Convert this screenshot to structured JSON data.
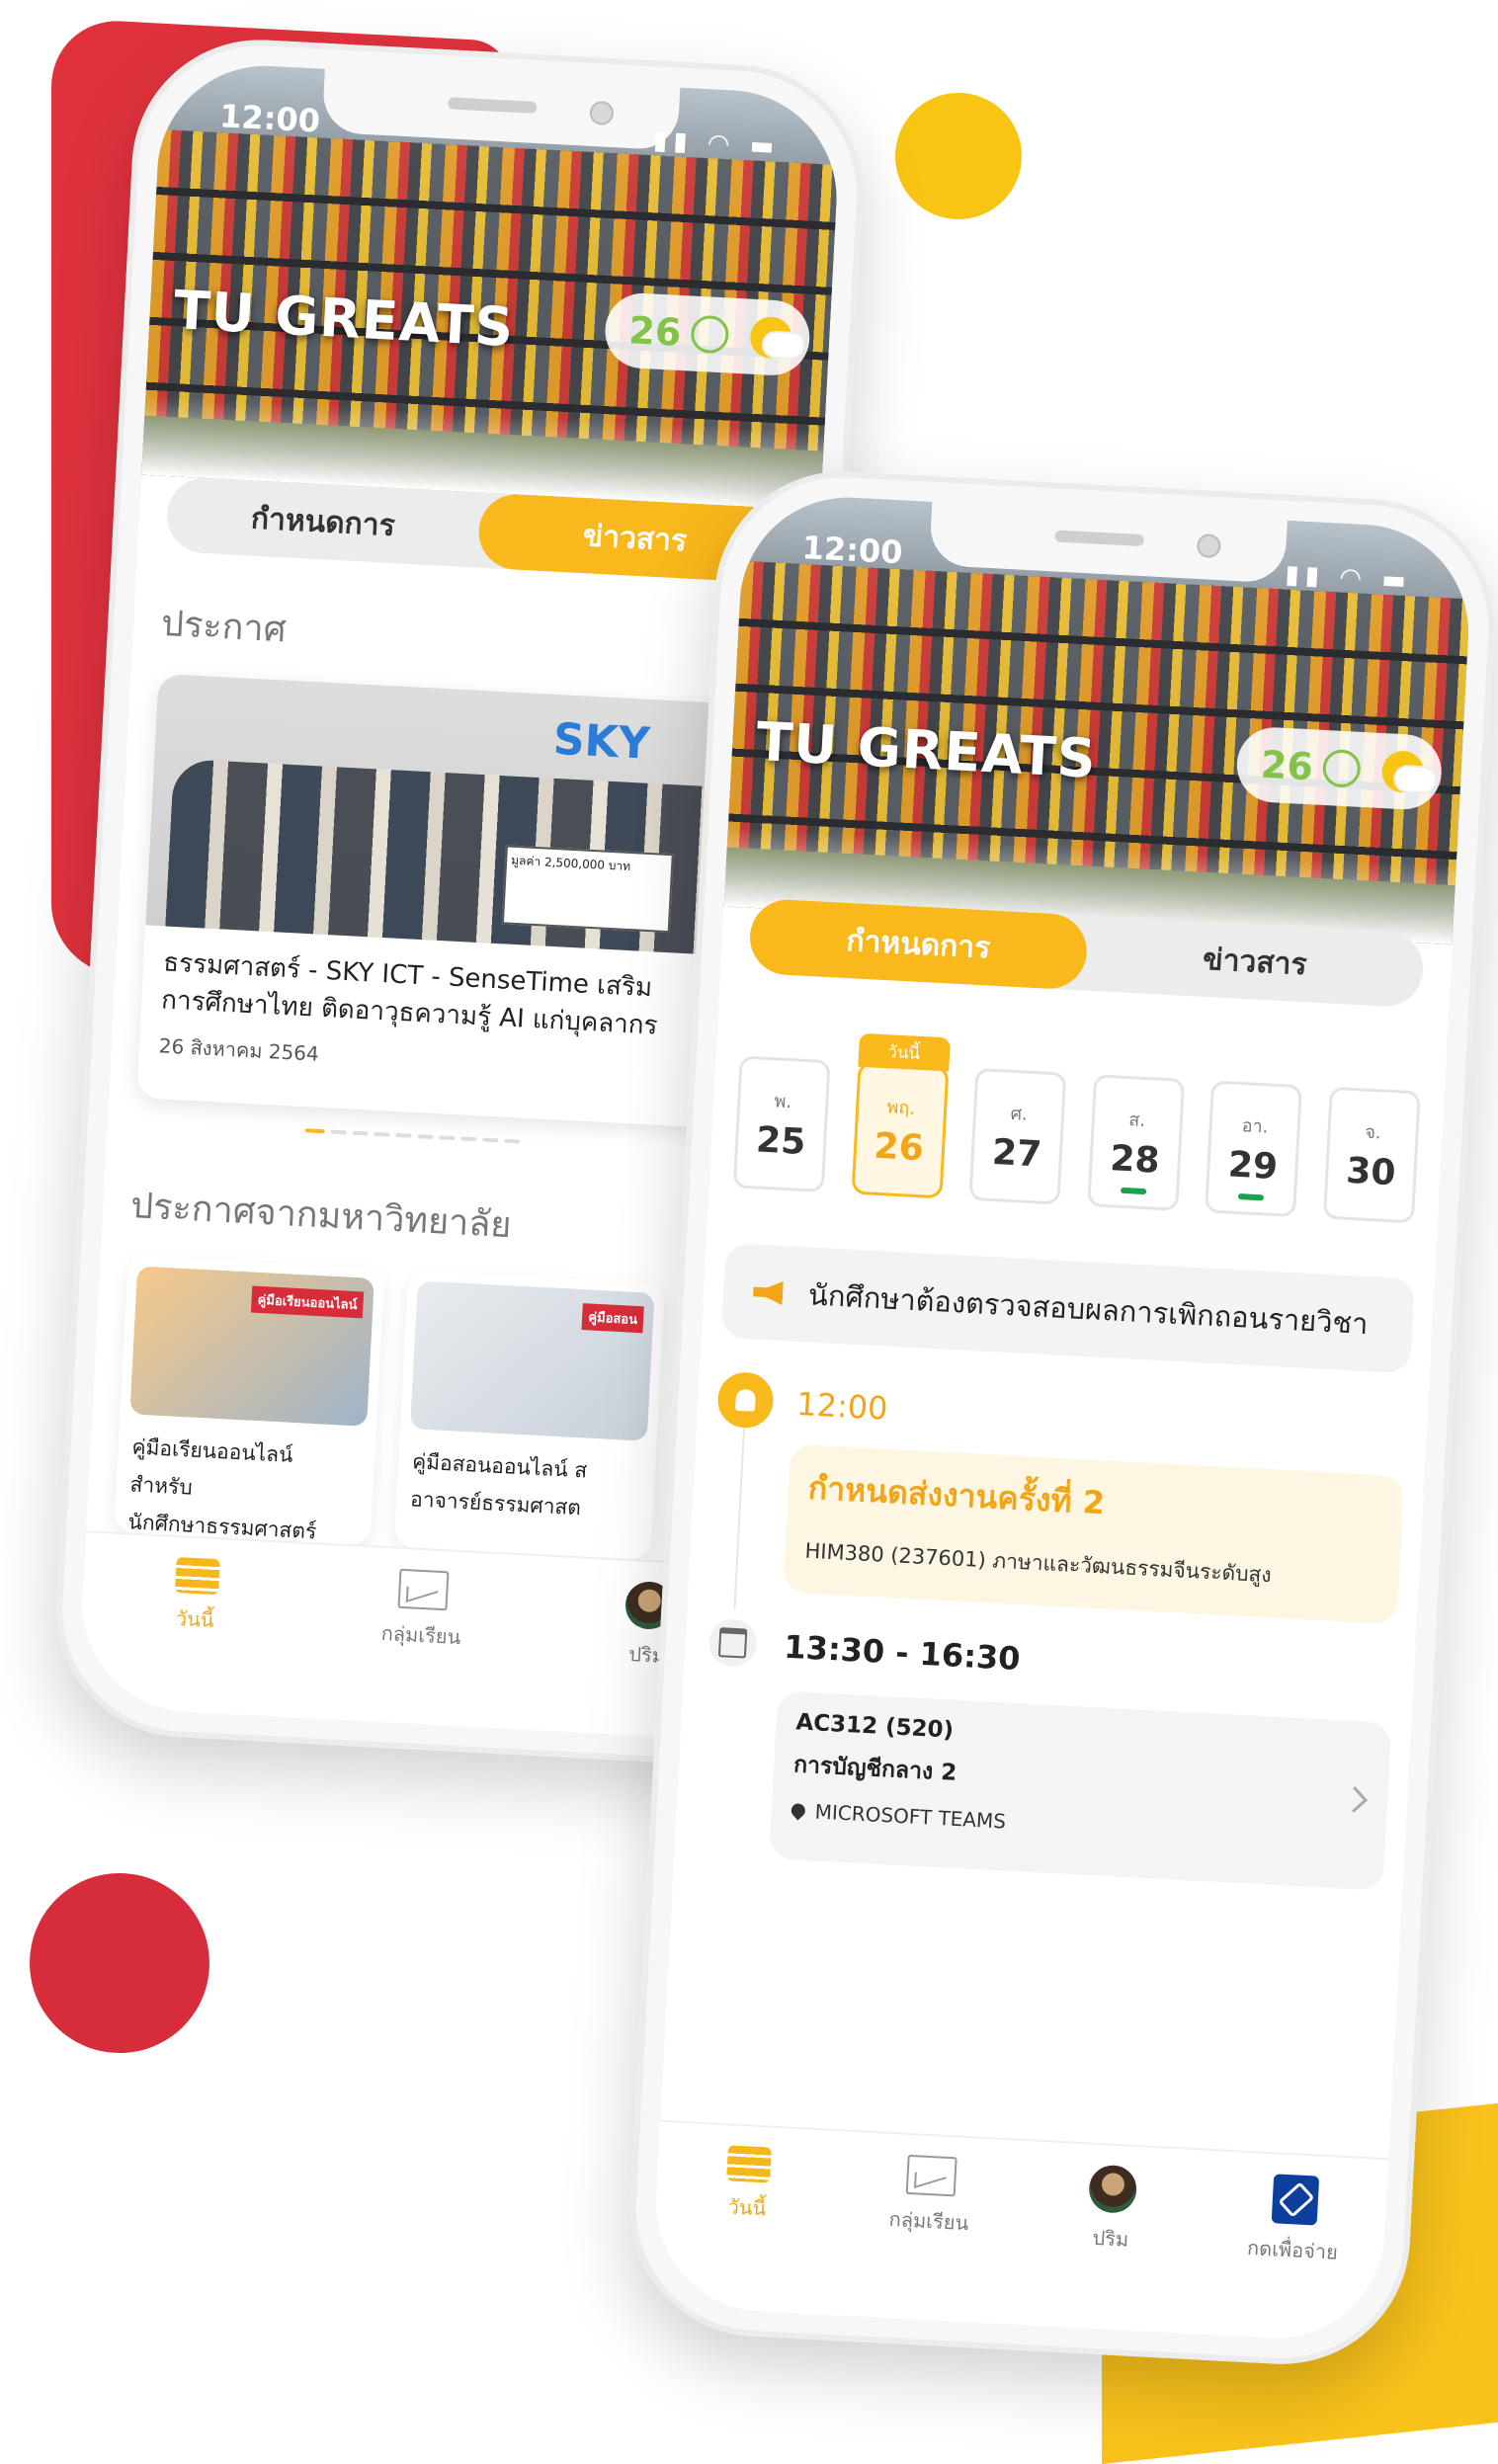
{
  "back_phone": {
    "status_time": "12:00",
    "app_title": "TU GREATS",
    "aqi_value": "26",
    "tabs": [
      "กำหนดการ",
      "ข่าวสาร"
    ],
    "announcement_title": "ประกาศ",
    "news": {
      "headline": "ธรรมศาสตร์ - SKY ICT - SenseTime เสริม",
      "headline2": "การศึกษาไทย ติดอาวุธความรู้ AI แก่บุคลากร",
      "date": "26 สิงหาคม 2564",
      "logo": "SKY",
      "check": "มูลค่า 2,500,000 บาท"
    },
    "university_title": "ประกาศจากมหาวิทยาลัย",
    "cards": [
      {
        "text1": "คู่มือเรียนออนไลน์ สำหรับ",
        "text2": "นักศึกษาธรรมศาสตร์",
        "badge": "คู่มือเรียนออนไลน์"
      },
      {
        "text1": "คู่มือสอนออนไลน์ ส",
        "text2": "อาจารย์ธรรมศาสต",
        "badge": "คู่มือสอน"
      }
    ],
    "tabbar": [
      "วันนี้",
      "กลุ่มเรียน",
      "ปริม"
    ]
  },
  "front_phone": {
    "status_time": "12:00",
    "app_title": "TU GREATS",
    "aqi_value": "26",
    "tabs": [
      "กำหนดการ",
      "ข่าวสาร"
    ],
    "today_tag": "วันนี้",
    "days": [
      {
        "dow": "พ.",
        "num": "25",
        "mark": false
      },
      {
        "dow": "พฤ.",
        "num": "26",
        "mark": false,
        "selected": true
      },
      {
        "dow": "ศ.",
        "num": "27",
        "mark": false
      },
      {
        "dow": "ส.",
        "num": "28",
        "mark": true
      },
      {
        "dow": "อา.",
        "num": "29",
        "mark": true
      },
      {
        "dow": "จ.",
        "num": "30",
        "mark": false
      }
    ],
    "notice": "นักศึกษาต้องตรวจสอบผลการเพิกถอนรายวิชา",
    "deadline": {
      "time": "12:00",
      "title": "กำหนดส่งงานครั้งที่ 2",
      "subtitle": "HIM380 (237601) ภาษาและวัฒนธรรมจีนระดับสูง"
    },
    "class": {
      "time": "13:30 - 16:30",
      "code": "AC312 (520)",
      "name": "การบัญชีกลาง 2",
      "location": "MICROSOFT TEAMS"
    },
    "tabbar": [
      "วันนี้",
      "กลุ่มเรียน",
      "ปริม",
      "กดเพื่อจ่าย"
    ]
  },
  "colors": {
    "accent": "#f9b81b",
    "brand_red": "#e0323d",
    "green": "#1aa34a",
    "pay_blue": "#0d3f9e"
  },
  "icons": [
    "megaphone-icon",
    "bell-icon",
    "calendar-icon",
    "pin-icon",
    "chevron-right-icon",
    "stack-icon",
    "chart-icon",
    "avatar-icon",
    "pay-icon",
    "sun-cloud-icon",
    "face-icon"
  ]
}
